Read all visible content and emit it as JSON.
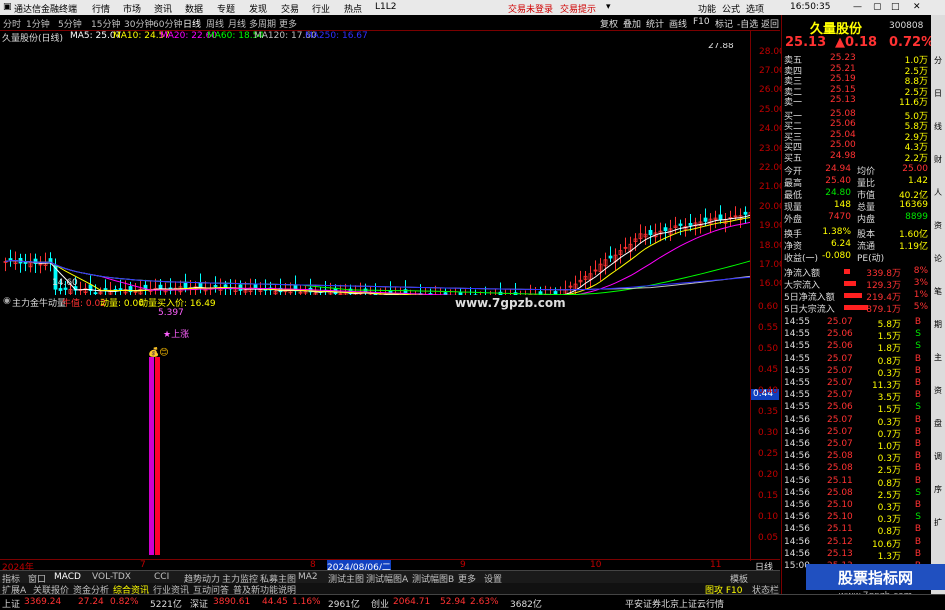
{
  "titlebar": {
    "app": "通达信金融终端",
    "menus": [
      "行情",
      "市场",
      "资讯",
      "数据",
      "专题",
      "发现",
      "交易",
      "行业",
      "热点",
      "L1L2"
    ],
    "login": "交易未登录",
    "alert": "交易提示",
    "right_menus": [
      "功能",
      "公式",
      "选项"
    ],
    "time": "16:50:35"
  },
  "toolbar": {
    "periods": [
      "分时",
      "1分钟",
      "5分钟",
      "15分钟",
      "30分钟",
      "60分钟",
      "日线",
      "周线",
      "月线",
      "多周期",
      "更多"
    ],
    "actions": [
      "复权",
      "叠加",
      "统计",
      "画线",
      "F10",
      "标记",
      "-自选",
      "返回"
    ]
  },
  "chartinfo": {
    "stock": "久量股份(日线)",
    "ma5": "MA5: 25.07",
    "ma10": "MA10: 24.57",
    "ma20": "MA20: 22.60",
    "ma60": "MA60: 18.54",
    "ma120": "MA120: 17.60",
    "ma250": "MA250: 16.67"
  },
  "colors": {
    "ma5": "#ffffff",
    "ma10": "#ffff00",
    "ma20": "#ff00ff",
    "ma60": "#00ff00",
    "ma120": "#c0c0c0",
    "ma250": "#3030ff",
    "up": "#ff3232",
    "down": "#00ffff"
  },
  "chart_data": {
    "type": "line",
    "price_axis": [
      "28.00",
      "27.00",
      "26.00",
      "25.00",
      "24.00",
      "23.00",
      "22.00",
      "21.00",
      "20.00",
      "19.00",
      "18.00",
      "17.00",
      "16.00"
    ],
    "high_label": "27.88",
    "low_label": "14.60",
    "ylim": [
      15.5,
      28.5
    ]
  },
  "indicator": {
    "title": "主力金牛动量",
    "field1": "牛值: 0.02",
    "field2": "动量: 0.00",
    "field3": "动量买入价: 16.49",
    "value_label": "5.397",
    "up_label": "上涨",
    "axis": [
      "0.60",
      "0.55",
      "0.50",
      "0.45",
      "0.40",
      "0.35",
      "0.30",
      "0.25",
      "0.20",
      "0.15",
      "0.10",
      "0.05"
    ],
    "marker": "0.44"
  },
  "site": "www.7gpzb.com",
  "dateaxis": {
    "labels": [
      "2024年",
      "7",
      "8",
      "2024/08/06/二",
      "9",
      "10",
      "11"
    ],
    "right": "日线"
  },
  "bottombar": {
    "tabs": [
      "指标",
      "窗口",
      "MACD",
      "VOL-TDX",
      "CCI",
      "趋势动力",
      "主力监控",
      "私募主图",
      "MA2",
      "测试主图",
      "测试幅图A",
      "测试幅图B",
      "更多",
      "设置"
    ],
    "row2": [
      "扩展A",
      "关联报价",
      "资金分析",
      "综合资讯",
      "行业资讯",
      "互动问答",
      "普及新功能说明"
    ],
    "right": "模板",
    "right2": "图攻 F10",
    "right3": "状态栏"
  },
  "statusbar": {
    "sh_name": "上证",
    "sh_val": "3369.24",
    "sh_chg": "27.24",
    "sh_pct": "0.82%",
    "sh_amt": "5221亿",
    "sz_name": "深证",
    "sz_val": "3890.61",
    "sz_chg": "44.45",
    "sz_pct": "1.16%",
    "sz_amt": "2961亿",
    "cy_name": "创业",
    "cy_val": "2064.71",
    "cy_chg": "52.94",
    "cy_pct": "2.63%",
    "cy_amt": "3682亿",
    "broker": "平安证券北京上证云行情"
  },
  "quote": {
    "name": "久量股份",
    "code": "300808",
    "price": "25.13",
    "change": "▲0.18",
    "pct": "0.72%",
    "sells": [
      {
        "label": "卖五",
        "price": "25.23",
        "vol": "1.0万"
      },
      {
        "label": "卖四",
        "price": "25.21",
        "vol": "2.5万"
      },
      {
        "label": "卖三",
        "price": "25.19",
        "vol": "8.8万"
      },
      {
        "label": "卖二",
        "price": "25.15",
        "vol": "2.5万"
      },
      {
        "label": "卖一",
        "price": "25.13",
        "vol": "11.6万"
      }
    ],
    "buys": [
      {
        "label": "买一",
        "price": "25.08",
        "vol": "5.0万"
      },
      {
        "label": "买二",
        "price": "25.06",
        "vol": "5.8万"
      },
      {
        "label": "买三",
        "price": "25.04",
        "vol": "2.9万"
      },
      {
        "label": "买四",
        "price": "25.00",
        "vol": "4.3万"
      },
      {
        "label": "买五",
        "price": "24.98",
        "vol": "2.2万"
      }
    ],
    "stats": [
      [
        "今开",
        "24.94",
        "均价",
        "25.00"
      ],
      [
        "最高",
        "25.40",
        "量比",
        "1.42"
      ],
      [
        "最低",
        "24.80",
        "市值",
        "40.2亿"
      ],
      [
        "现量",
        "148",
        "总量",
        "16369"
      ],
      [
        "外盘",
        "7470",
        "内盘",
        "8899"
      ]
    ],
    "stats2": [
      [
        "换手",
        "1.38%",
        "股本",
        "1.60亿"
      ],
      [
        "净资",
        "6.24",
        "流通",
        "1.19亿"
      ],
      [
        "收益(一)",
        "-0.080",
        "PE(动)",
        ""
      ]
    ],
    "flows": [
      [
        "净流入额",
        "339.8万",
        "8%"
      ],
      [
        "大宗流入",
        "129.3万",
        "3%"
      ],
      [
        "5日净流入额",
        "219.4万",
        "1%"
      ],
      [
        "5日大宗流入",
        "879.1万",
        "5%"
      ]
    ],
    "ticks": [
      [
        "14:55",
        "25.07",
        "5.8万",
        "B"
      ],
      [
        "14:55",
        "25.06",
        "1.5万",
        "S"
      ],
      [
        "14:55",
        "25.06",
        "1.8万",
        "S"
      ],
      [
        "14:55",
        "25.07",
        "0.8万",
        "B"
      ],
      [
        "14:55",
        "25.07",
        "0.3万",
        "B"
      ],
      [
        "14:55",
        "25.07",
        "11.3万",
        "B"
      ],
      [
        "14:55",
        "25.07",
        "3.5万",
        "B"
      ],
      [
        "14:55",
        "25.06",
        "1.5万",
        "S"
      ],
      [
        "14:56",
        "25.07",
        "0.3万",
        "B"
      ],
      [
        "14:56",
        "25.07",
        "0.7万",
        "B"
      ],
      [
        "14:56",
        "25.07",
        "1.0万",
        "B"
      ],
      [
        "14:56",
        "25.08",
        "0.3万",
        "B"
      ],
      [
        "14:56",
        "25.08",
        "2.5万",
        "B"
      ],
      [
        "14:56",
        "25.11",
        "0.8万",
        "B"
      ],
      [
        "14:56",
        "25.08",
        "2.5万",
        "S"
      ],
      [
        "14:56",
        "25.10",
        "0.3万",
        "B"
      ],
      [
        "14:56",
        "25.10",
        "0.3万",
        "S"
      ],
      [
        "14:56",
        "25.11",
        "0.8万",
        "B"
      ],
      [
        "14:56",
        "25.12",
        "10.6万",
        "B"
      ],
      [
        "14:56",
        "25.13",
        "1.3万",
        "B"
      ],
      [
        "15:00",
        "25.13",
        "",
        "B"
      ]
    ]
  },
  "rightside": [
    "分",
    "日",
    "线",
    "财",
    "人",
    "资",
    "论",
    "笔",
    "期",
    "主",
    "资",
    "盘",
    "调",
    "序",
    "扩"
  ],
  "watermark": "股票指标网",
  "watermark2": "www.7gpzb.com"
}
